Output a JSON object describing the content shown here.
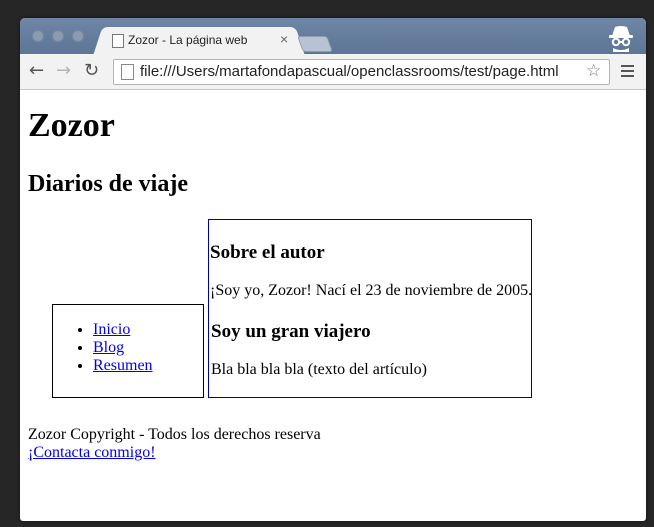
{
  "browser": {
    "tab_title": "Zozor - La página web",
    "tab_close": "×",
    "url": "file:///Users/martafondapascual/openclassrooms/test/page.html",
    "back_glyph": "←",
    "forward_glyph": "→",
    "reload_glyph": "↻",
    "star_glyph": "☆"
  },
  "page": {
    "title": "Zozor",
    "subtitle": "Diarios de viaje",
    "nav": [
      "Inicio",
      "Blog",
      "Resumen"
    ],
    "section1_heading": "Sobre el autor",
    "section1_text": "¡Soy yo, Zozor! Nací el 23 de noviembre de 2005.",
    "section2_heading": "Soy un gran viajero",
    "section2_text": "Bla bla bla bla (texto del artículo)",
    "footer_text": "Zozor Copyright - Todos los derechos reserva",
    "footer_link": "¡Contacta conmigo!"
  },
  "colors": {
    "tabstrip": "#6f86a6",
    "link": "#0000ee",
    "article_border": "#0000aa"
  }
}
